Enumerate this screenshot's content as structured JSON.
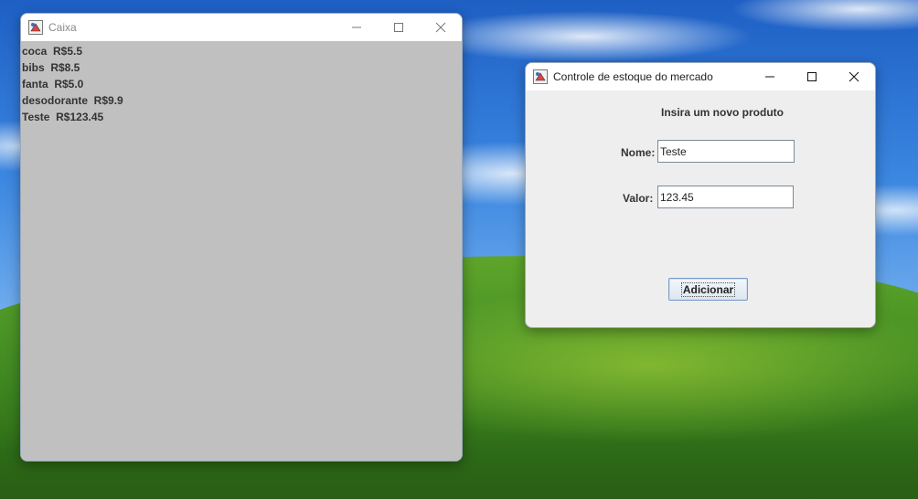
{
  "caixa_window": {
    "title": "Caixa",
    "items": [
      {
        "text": "coca  R$5.5"
      },
      {
        "text": "bibs  R$8.5"
      },
      {
        "text": "fanta  R$5.0"
      },
      {
        "text": "desodorante  R$9.9"
      },
      {
        "text": "Teste  R$123.45"
      }
    ]
  },
  "estoque_window": {
    "title": "Controle de estoque do mercado",
    "heading": "Insira um novo produto",
    "nome_label": "Nome:",
    "nome_value": "Teste",
    "valor_label": "Valor:",
    "valor_value": "123.45",
    "add_button_label": "Adicionar"
  },
  "icons": {
    "app": "java-app-icon",
    "minimize": "minimize-icon",
    "maximize": "maximize-icon",
    "close": "close-icon"
  },
  "colors": {
    "list_background": "#c0c0c0",
    "form_background": "#eeeeee",
    "titlebar": "#ffffff"
  }
}
